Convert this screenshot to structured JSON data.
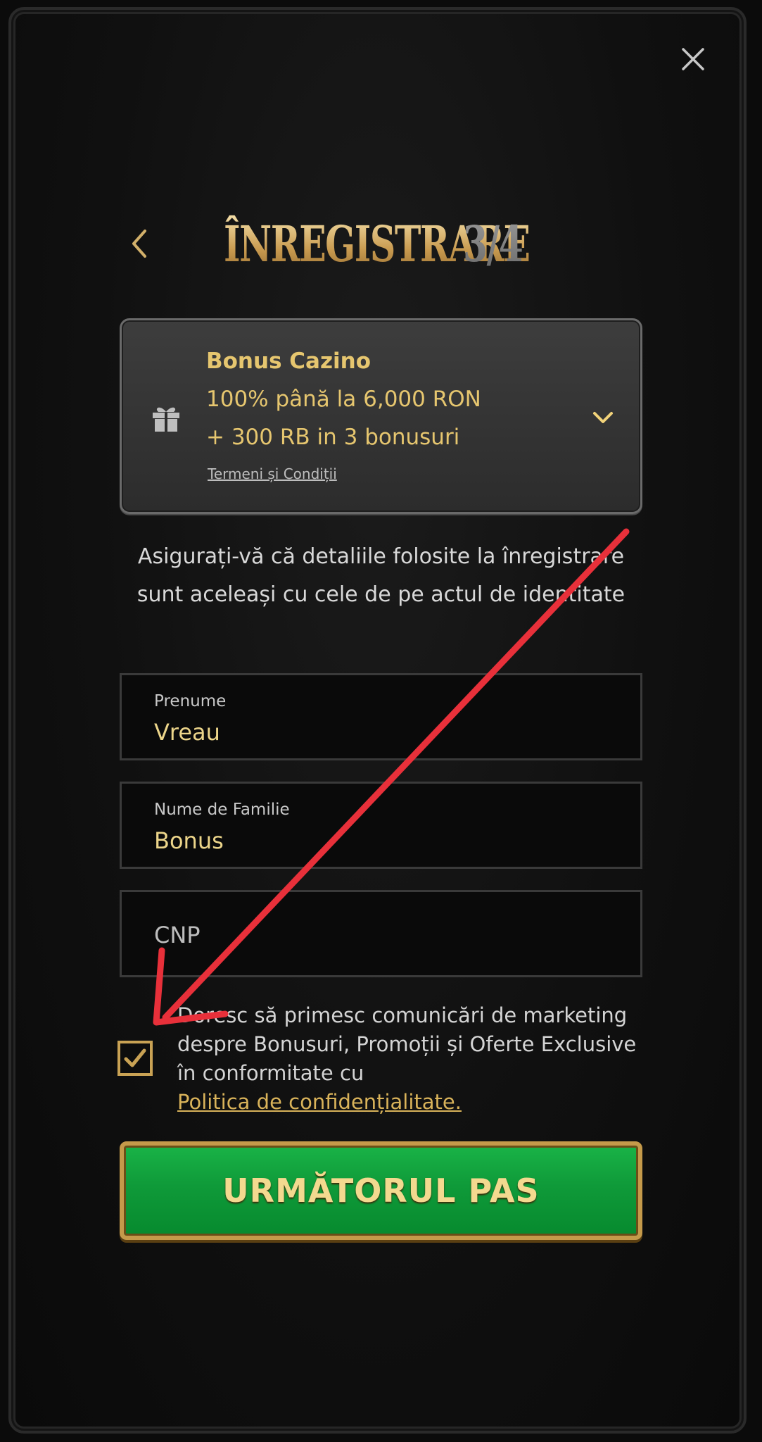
{
  "header": {
    "title": "ÎNREGISTRARE",
    "step": "3/4",
    "close_icon": "close-icon",
    "back_icon": "chevron-left-icon"
  },
  "bonus": {
    "title": "Bonus Cazino",
    "line1": "100% până la 6,000 RON",
    "line2": "+ 300 RB in 3 bonusuri",
    "terms_link": "Termeni și Condiții",
    "icon": "gift-icon",
    "expand_icon": "chevron-down-icon"
  },
  "notice": "Asigurați-vă că detaliile folosite la înregistrare sunt aceleași cu cele de pe actul de identitate",
  "form": {
    "first_name": {
      "label": "Prenume",
      "value": "Vreau"
    },
    "last_name": {
      "label": "Nume de Familie",
      "value": "Bonus"
    },
    "cnp": {
      "placeholder": "CNP"
    }
  },
  "consent": {
    "checked": true,
    "text": "Doresc să primesc comunicări de marketing despre Bonusuri, Promoții și Oferte Exclusive în conformitate cu",
    "link": "Politica de confidențialitate."
  },
  "next_button": "URMĂTORUL PAS",
  "colors": {
    "gold": "#e6c66f",
    "green": "#0f9a39",
    "annotation_red": "#e8303a"
  }
}
